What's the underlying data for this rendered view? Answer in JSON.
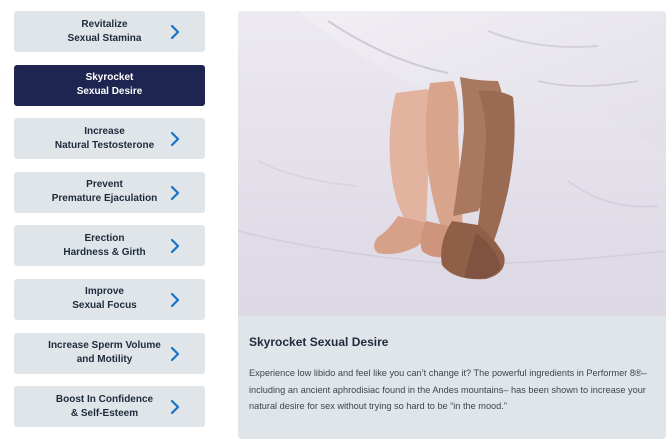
{
  "tabs": [
    {
      "label": "Revitalize\nSexual Stamina",
      "active": false
    },
    {
      "label": "Skyrocket\nSexual Desire",
      "active": true
    },
    {
      "label": "Increase\nNatural Testosterone",
      "active": false
    },
    {
      "label": "Prevent\nPremature Ejaculation",
      "active": false
    },
    {
      "label": "Erection\nHardness & Girth",
      "active": false
    },
    {
      "label": "Improve\nSexual Focus",
      "active": false
    },
    {
      "label": "Increase Sperm Volume\nand Motility",
      "active": false
    },
    {
      "label": "Boost In Confidence\n& Self-Esteem",
      "active": false
    }
  ],
  "panel": {
    "title": "Skyrocket Sexual Desire",
    "body": "Experience low libido and feel like you can’t change it? The powerful ingredients in Performer 8®– including an ancient aphrodisiac found in the Andes mountains– has been shown to increase your natural desire for sex without trying so hard to be “in the mood.”"
  },
  "colors": {
    "tab_bg": "#dfe5e8",
    "tab_active_bg": "#1e2551",
    "chevron": "#1a73c8",
    "text_dark": "#1e2b3c"
  },
  "icons": {
    "tab_arrow": "chevron-right-icon"
  }
}
